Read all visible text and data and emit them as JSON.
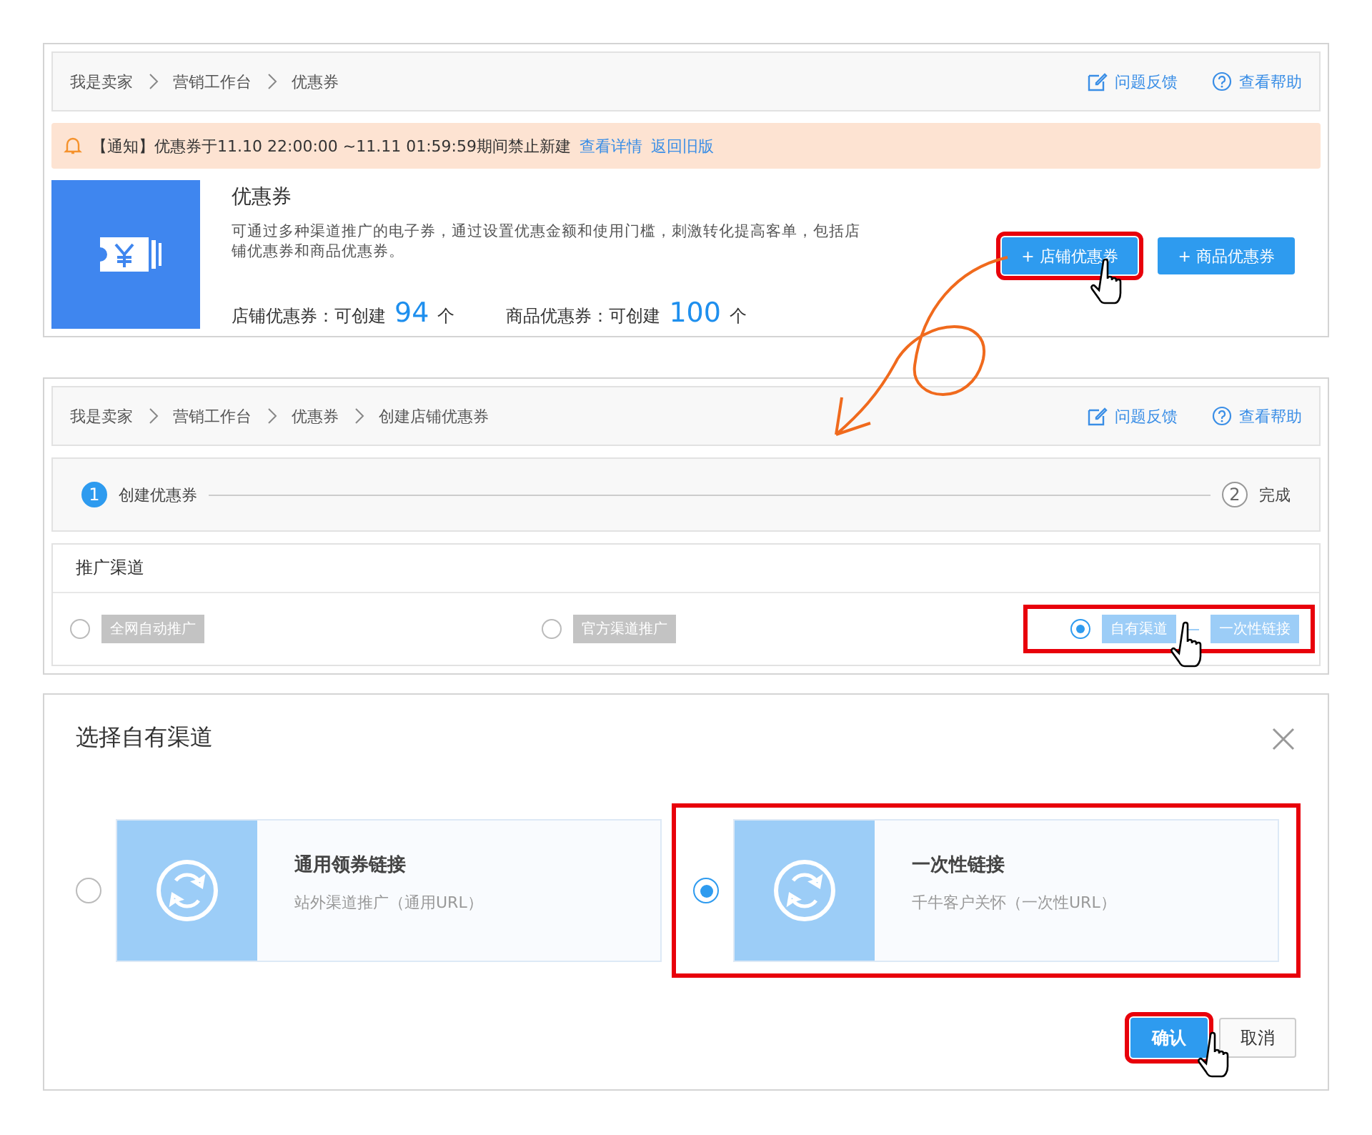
{
  "panel_1": {
    "breadcrumb": [
      "我是卖家",
      "营销工作台",
      "优惠券"
    ],
    "actions": [
      {
        "label": "问题反馈"
      },
      {
        "label": "查看帮助"
      }
    ],
    "notice": {
      "text": "【通知】优惠券于11.10 22:00:00 ~11.11 01:59:59期间禁止新建",
      "links": [
        "查看详情",
        "返回旧版"
      ]
    },
    "title": "优惠券",
    "description": "可通过多种渠道推广的电子券，通过设置优惠金额和使用门槛，刺激转化提高客单，包括店铺优惠券和商品优惠券。",
    "buttons": [
      {
        "label": "+ 店铺优惠券",
        "highlighted": true,
        "pointer": true
      },
      {
        "label": "+ 商品优惠券",
        "highlighted": false,
        "pointer": false
      }
    ],
    "quotas": [
      {
        "label": "店铺优惠券：可创建",
        "count": "94",
        "unit": "个"
      },
      {
        "label": "商品优惠券：可创建",
        "count": "100",
        "unit": "个"
      }
    ]
  },
  "panel_2": {
    "breadcrumb": [
      "我是卖家",
      "营销工作台",
      "优惠券",
      "创建店铺优惠券"
    ],
    "actions": [
      {
        "label": "问题反馈"
      },
      {
        "label": "查看帮助"
      }
    ],
    "steps": [
      {
        "number": "1",
        "label": "创建优惠券",
        "selected": true
      },
      {
        "number": "2",
        "label": "完成",
        "selected": false
      }
    ],
    "section_title": "推广渠道",
    "channels": [
      {
        "label": "全网自动推广",
        "selected": false,
        "highlighted": false,
        "pointer": false
      },
      {
        "label": "官方渠道推广",
        "selected": false,
        "highlighted": false,
        "pointer": false
      },
      {
        "label": "自有渠道",
        "selected": true,
        "tag": "一次性链接",
        "highlighted": true,
        "pointer": true
      }
    ]
  },
  "dialog": {
    "title": "选择自有渠道",
    "options": [
      {
        "title": "通用领券链接",
        "subtitle": "站外渠道推广（通用URL）",
        "selected": false,
        "highlighted": false
      },
      {
        "title": "一次性链接",
        "subtitle": "千牛客户关怀（一次性URL）",
        "selected": true,
        "highlighted": true
      }
    ],
    "buttons": [
      {
        "label": "确认",
        "kind": "primary",
        "highlighted": true,
        "pointer": true
      },
      {
        "label": "取消",
        "kind": "default",
        "highlighted": false,
        "pointer": false
      }
    ]
  }
}
